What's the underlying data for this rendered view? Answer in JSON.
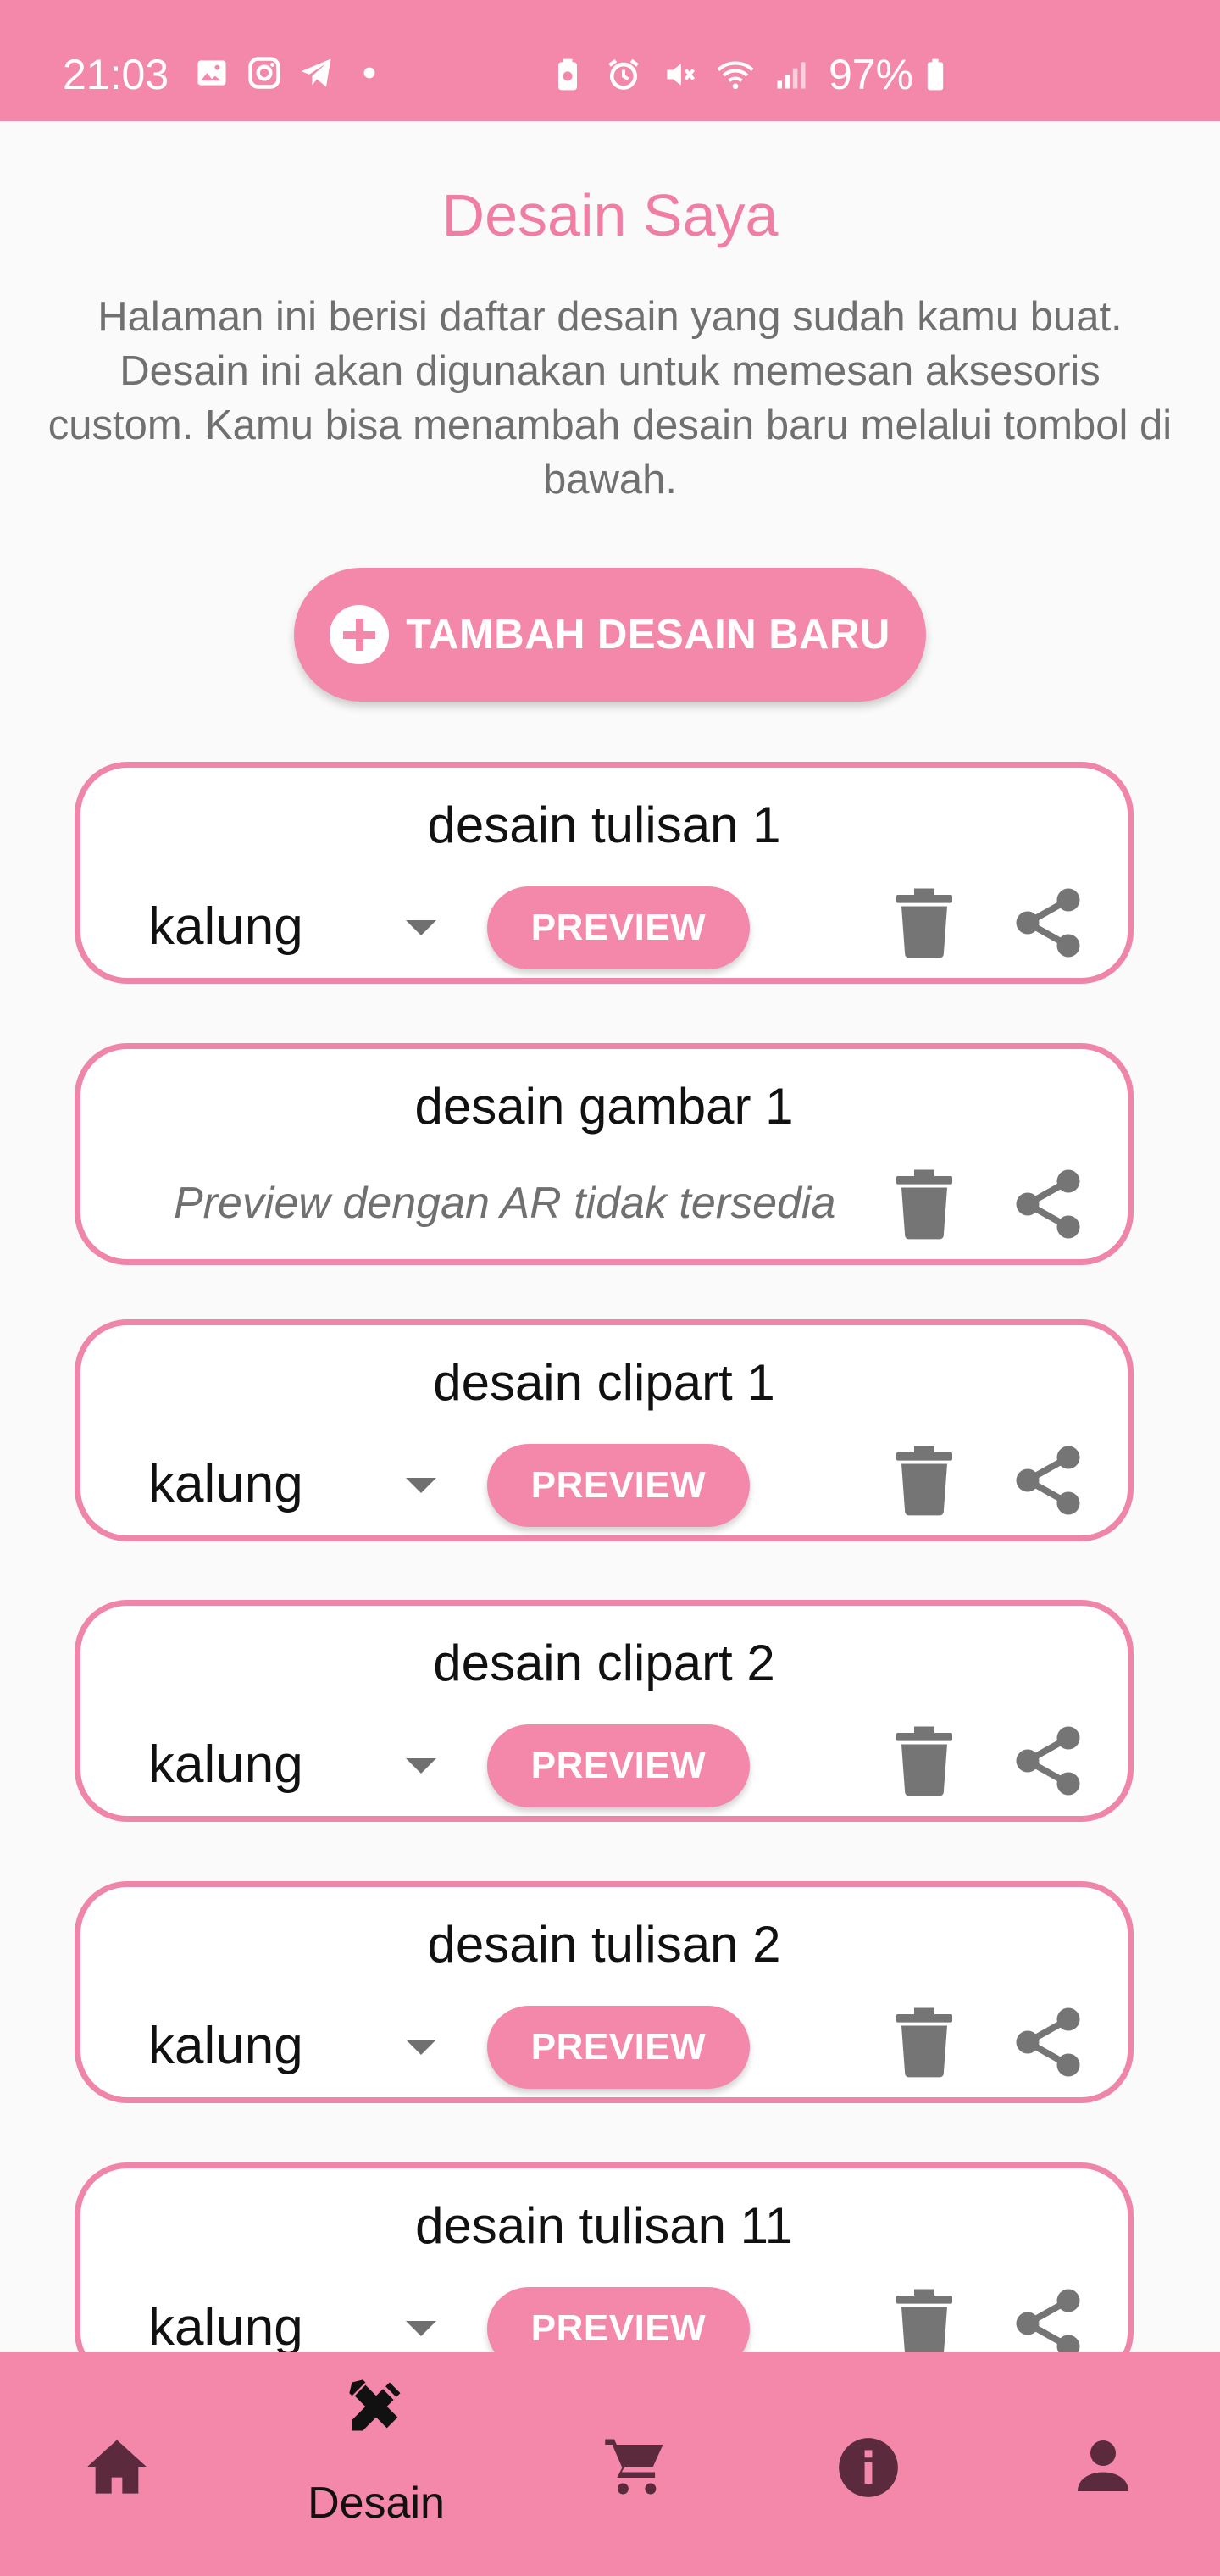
{
  "status_bar": {
    "time": "21:03",
    "battery": "97%"
  },
  "header": {
    "title": "Desain Saya",
    "description": "Halaman ini berisi daftar desain yang sudah kamu buat. Desain ini akan digunakan untuk memesan aksesoris custom. Kamu bisa menambah desain baru melalui tombol di bawah."
  },
  "add_button": {
    "label": "TAMBAH DESAIN BARU"
  },
  "designs": [
    {
      "name": "desain tulisan 1",
      "type": "kalung",
      "action": "PREVIEW"
    },
    {
      "name": "desain gambar 1",
      "note": "Preview dengan AR tidak tersedia"
    },
    {
      "name": "desain clipart 1",
      "type": "kalung",
      "action": "PREVIEW"
    },
    {
      "name": "desain clipart 2",
      "type": "kalung",
      "action": "PREVIEW"
    },
    {
      "name": "desain tulisan 2",
      "type": "kalung",
      "action": "PREVIEW"
    },
    {
      "name": "desain tulisan 11",
      "type": "kalung",
      "action": "PREVIEW"
    }
  ],
  "bottom_nav": {
    "items": [
      {
        "icon": "home-icon"
      },
      {
        "icon": "design-icon",
        "label": "Desain",
        "active": true
      },
      {
        "icon": "cart-icon"
      },
      {
        "icon": "info-icon"
      },
      {
        "icon": "person-icon"
      }
    ]
  },
  "colors": {
    "accent": "#f488ab",
    "title": "#f07ea3",
    "icon_gray": "#757575",
    "nav_icon": "#5b2a3c"
  }
}
